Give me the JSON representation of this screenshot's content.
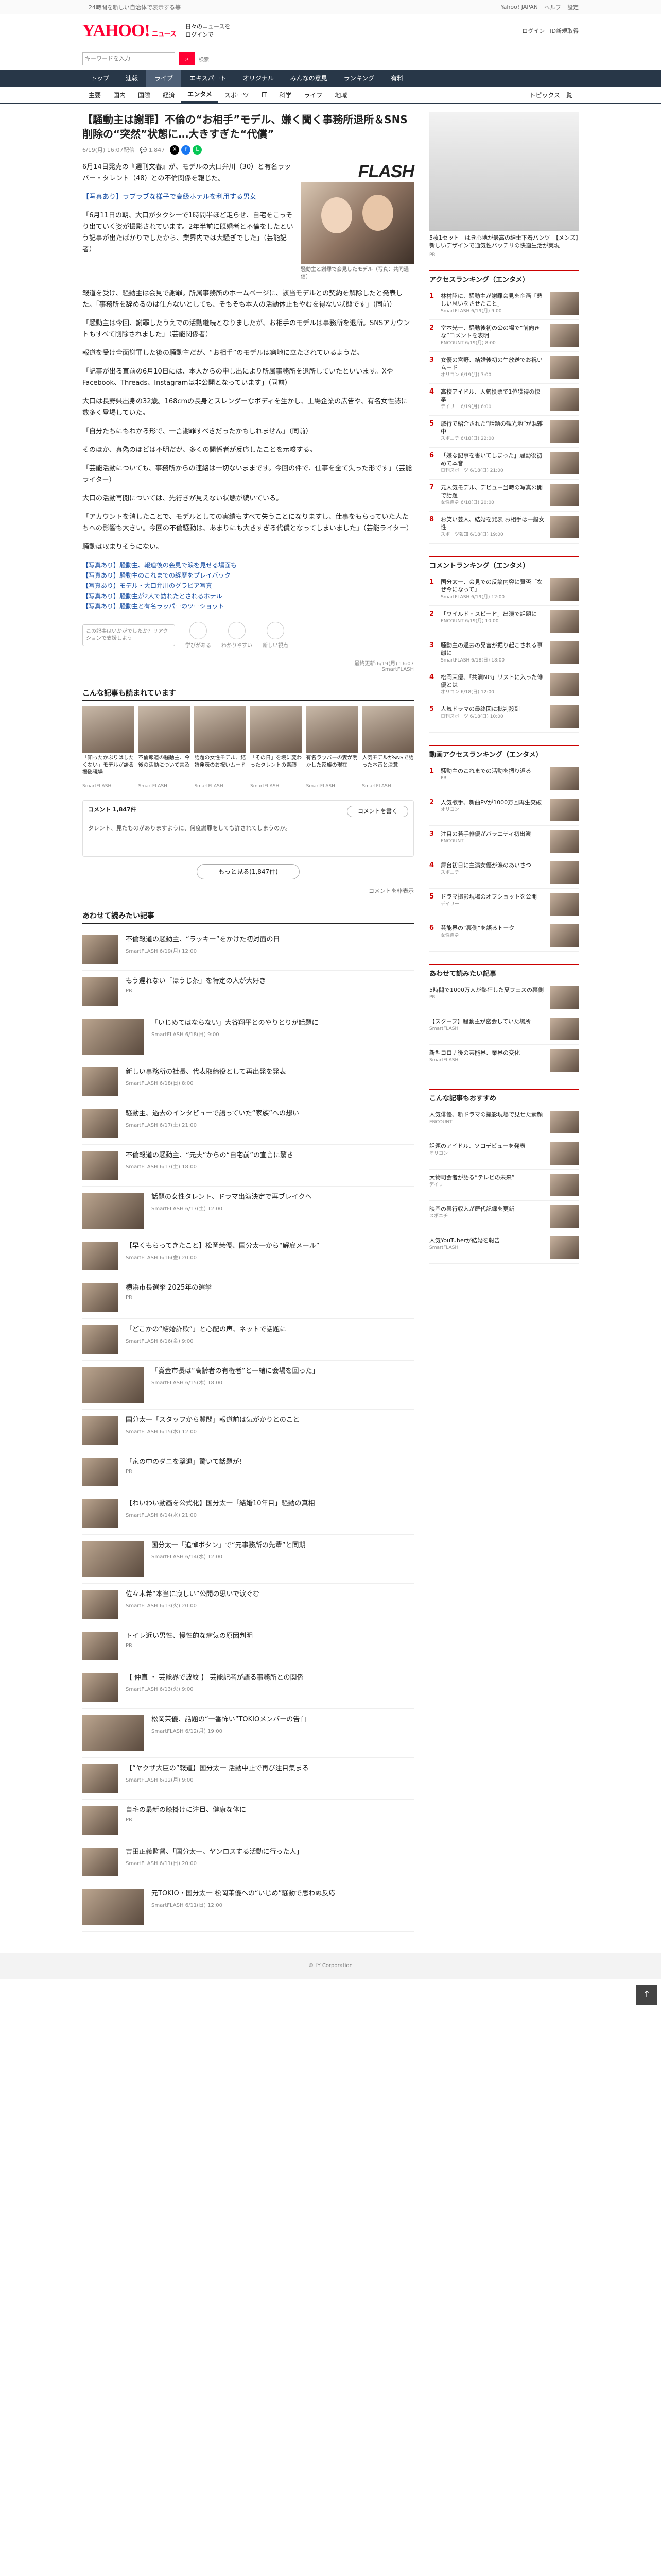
{
  "topbar": {
    "notice": "24時間を新しい自治体で表示する等",
    "login": "Yahoo! JAPAN",
    "help": "ヘルプ",
    "settings": "設定"
  },
  "header": {
    "logo": "YAHOO!",
    "logo_sub": "ニュース",
    "tagline1": "日々のニュースを",
    "tagline2": "ログインで",
    "links": [
      "ログイン",
      "ID新規取得"
    ]
  },
  "search": {
    "placeholder": "キーワードを入力",
    "button": "検索"
  },
  "nav": [
    "トップ",
    "速報",
    "ライブ",
    "エキスパート",
    "オリジナル",
    "みんなの意見",
    "ランキング",
    "有料"
  ],
  "subnav": [
    "主要",
    "国内",
    "国際",
    "経済",
    "エンタメ",
    "スポーツ",
    "IT",
    "科学",
    "ライフ",
    "地域"
  ],
  "subnav_right": "トピックス一覧",
  "article": {
    "title": "【騒動主は謝罪】不倫の“お相手”モデル、嫌く聞く事務所退所＆SNS削除の“突然”状態に…大きすぎた“代償”",
    "date": "6/19(月) 16:07配信",
    "comments": "1,847",
    "flash": "FLASH",
    "caption": "騒動主と謝罪で会見したモデル（写真：共同通信）",
    "paragraphs": [
      "6月14日発売の『週刊文春』が、モデルの大口弁川（30）と有名ラッパー・タレント（48）との不倫関係を報じた。",
      "【写真あり】ラブラブな様子で高級ホテルを利用する男女",
      "「6月11日の朝、大口がタクシーで1時間半ほど走らせ、自宅をこっそり出ていく姿が撮影されています。2年半前に既婚者と不倫をしたという記事が出たばかりでしたから、業界内では大騒ぎでした」（芸能記者）",
      "報道を受け、騒動主は会見で謝罪。所属事務所のホームページに、該当モデルとの契約を解除したと発表した。「事務所を辞めるのは仕方ないとしても、そもそも本人の活動休止もやむを得ない状態です」（同前）",
      "「騒動主は今回、謝罪したうえでの活動継続となりましたが、お相手のモデルは事務所を退所。SNSアカウントもすべて削除されました」（芸能関係者）",
      "報道を受け全面謝罪した後の騒動主だが、“お相手”のモデルは窮地に立たされているようだ。",
      "「記事が出る直前の6月10日には、本人からの申し出により所属事務所を退所していたといいます。XやFacebook、Threads、Instagramは非公開となっています」（同前）",
      "大口は長野県出身の32歳。168cmの長身とスレンダーなボディを生かし、上場企業の広告や、有名女性誌に数多く登場していた。",
      "「自分たちにもわかる形で、一言謝罪すべきだったかもしれません」（同前）",
      "そのほか、真偽のほどは不明だが、多くの関係者が反応したことを示唆する。",
      "「芸能活動についても、事務所からの連絡は一切ないままです。今回の件で、仕事を全て失った形です」（芸能ライター）",
      "大口の活動再開については、先行きが見えない状態が続いている。",
      "「アカウントを消したことで、モデルとしての実績もすべて失うことになりますし、仕事をもらっていた人たちへの影響も大きい。今回の不倫騒動は、あまりにも大きすぎる代償となってしまいました」（芸能ライター）",
      "騒動は収まりそうにない。"
    ],
    "related_links": [
      "【写真あり】騒動主、報道後の会見で涙を見せる場面も",
      "【写真あり】騒動主のこれまでの経歴をプレイバック",
      "【写真あり】モデル・大口弁川のグラビア写真",
      "【写真あり】騒動主が2人で訪れたとされるホテル",
      "【写真あり】騒動主と有名ラッパーのツーショット"
    ],
    "reaction_bubble": "この記事はいかがでしたか？リアクションで支援しよう",
    "reactions": [
      "学びがある",
      "わかりやすい",
      "新しい視点"
    ],
    "source": "最終更新:6/19(月) 16:07",
    "source_name": "SmartFLASH"
  },
  "related_section": "こんな記事も読まれています",
  "related": [
    {
      "title": "「知ったかぶりはしたくない」モデルが語る撮影現場",
      "caption": "SmartFLASH"
    },
    {
      "title": "不倫報道の騒動主、今後の活動について言及",
      "caption": "SmartFLASH"
    },
    {
      "title": "話題の女性モデル、結婚発表のお祝いムード",
      "caption": "SmartFLASH"
    },
    {
      "title": "「その日」を境に変わったタレントの素顔",
      "caption": "SmartFLASH"
    },
    {
      "title": "有名ラッパーの妻が明かした家族の現在",
      "caption": "SmartFLASH"
    },
    {
      "title": "人気モデルがSNSで語った本音と決意",
      "caption": "SmartFLASH"
    }
  ],
  "comments": {
    "title": "コメント 1,847件",
    "policy": "コメントを書く",
    "sample": "タレント、見たものがありますように、何度謝罪をしても許されてしまうのか。",
    "more": "もっと見る(1,847件)",
    "toggle": "コメントを非表示"
  },
  "list_section": "あわせて読みたい記事",
  "list": [
    {
      "title": "不倫報道の騒動主、“ラッキー”をかけた初対面の日",
      "caption": "SmartFLASH 6/19(月) 12:00"
    },
    {
      "title": "もう遅れない「ほうじ茶」を特定の人が大好き",
      "caption": "PR"
    },
    {
      "title": "「いじめてはならない」大谷翔平とのやりとりが話題に",
      "caption": "SmartFLASH 6/18(日) 9:00"
    },
    {
      "title": "新しい事務所の社長、代表取締役として再出発を発表",
      "caption": "SmartFLASH 6/18(日) 8:00"
    },
    {
      "title": "騒動主、過去のインタビューで語っていた“家族”への想い",
      "caption": "SmartFLASH 6/17(土) 21:00"
    },
    {
      "title": "不倫報道の騒動主、“元夫”からの“自宅前”の宣言に驚き",
      "caption": "SmartFLASH 6/17(土) 18:00"
    },
    {
      "title": "話題の女性タレント、ドラマ出演決定で再ブレイクへ",
      "caption": "SmartFLASH 6/17(土) 12:00"
    },
    {
      "title": "【早くもらってきたこと】松岡茉優、国分太一から“解雇メール”",
      "caption": "SmartFLASH 6/16(金) 20:00"
    },
    {
      "title": "横浜市長選挙 2025年の選挙",
      "caption": "PR"
    },
    {
      "title": "「どこかの“結婚詐欺”」と心配の声、ネットで話題に",
      "caption": "SmartFLASH 6/16(金) 9:00"
    },
    {
      "title": "「賞金市長は“高齢者の有権者”と一緒に会場を回った」",
      "caption": "SmartFLASH 6/15(木) 18:00"
    },
    {
      "title": "国分太一「スタッフから質問」報道前は気がかりとのこと",
      "caption": "SmartFLASH 6/15(木) 12:00"
    },
    {
      "title": "「家の中のダニを撃退」驚いて話題が！",
      "caption": "PR"
    },
    {
      "title": "【わいわい動画を公式化】国分太一「結婚10年目」騒動の真相",
      "caption": "SmartFLASH 6/14(水) 21:00"
    },
    {
      "title": "国分太一「追悼ボタン」で“元事務所の先輩”と同期",
      "caption": "SmartFLASH 6/14(水) 12:00"
    },
    {
      "title": "佐々木希“本当に寂しい”公開の思いで涙ぐむ",
      "caption": "SmartFLASH 6/13(火) 20:00"
    },
    {
      "title": "トイレ近い男性、慢性的な病気の原因判明",
      "caption": "PR"
    },
    {
      "title": "【 仲直 ・ 芸能界で波紋 】 芸能記者が語る事務所との関係",
      "caption": "SmartFLASH 6/13(火) 9:00"
    },
    {
      "title": "松岡茉優、話題の“一番怖い”TOKIOメンバーの告白",
      "caption": "SmartFLASH 6/12(月) 19:00"
    },
    {
      "title": "【“ヤクザ大臣の”報道】国分太一 活動中止で再び注目集まる",
      "caption": "SmartFLASH 6/12(月) 9:00"
    },
    {
      "title": "自宅の最新の膝掛けに注目、健康な体に",
      "caption": "PR"
    },
    {
      "title": "吉田正義監督、「国分太一、ヤンロスする活動に行った人」",
      "caption": "SmartFLASH 6/11(日) 20:00"
    },
    {
      "title": "元TOKIO・国分太一 松岡茉優への“いじめ”騒動で思わぬ反応",
      "caption": "SmartFLASH 6/11(日) 12:00"
    }
  ],
  "sidebar": {
    "ad_caption": "5枚1セット　はき心地が最高の紳士下着パンツ　【メンズ】新しいデザインで通気性バッチリの快適生活が実現",
    "ad_source": "PR",
    "access_title": "アクセスランキング（エンタメ）",
    "access": [
      {
        "title": "林村陸に、騒動主が謝罪会見を企画「悲しい思いをさせたこと」",
        "caption": "SmartFLASH 6/19(月) 9:00"
      },
      {
        "title": "堂本光一、騒動後初の公の場で“前向きな”コメントを表明",
        "caption": "ENCOUNT 6/19(月) 8:00"
      },
      {
        "title": "女優の宮野、結婚後初の生放送でお祝いムード",
        "caption": "オリコン 6/19(月) 7:00"
      },
      {
        "title": "高校アイドル、人気投票で1位獲得の快挙",
        "caption": "デイリー 6/19(月) 6:00"
      },
      {
        "title": "旅行で紹介された“話題の観光地”が混雑中",
        "caption": "スポニチ 6/18(日) 22:00"
      },
      {
        "title": "「嫌な記事を書いてしまった」騒動後初めて本音",
        "caption": "日刊スポーツ 6/18(日) 21:00"
      },
      {
        "title": "元人気モデル、デビュー当時の写真公開で話題",
        "caption": "女性自身 6/18(日) 20:00"
      },
      {
        "title": "お笑い芸人、結婚を発表 お相手は一般女性",
        "caption": "スポーツ報知 6/18(日) 19:00"
      }
    ],
    "comment_title": "コメントランキング（エンタメ）",
    "comment_rank": [
      {
        "title": "国分太一、会見での反論内容に賛否「なぜ今になって」",
        "caption": "SmartFLASH 6/19(月) 12:00"
      },
      {
        "title": "「ワイルド・スピード」出演で話題に",
        "caption": "ENCOUNT 6/19(月) 10:00"
      },
      {
        "title": "騒動主の過去の発言が掘り起こされる事態に",
        "caption": "SmartFLASH 6/18(日) 18:00"
      },
      {
        "title": "松岡茉優、「共演NG」リストに入った俳優とは",
        "caption": "オリコン 6/18(日) 12:00"
      },
      {
        "title": "人気ドラマの最終回に批判殺到",
        "caption": "日刊スポーツ 6/18(日) 10:00"
      }
    ],
    "playlist_title": "動画アクセスランキング（エンタメ）",
    "playlist": [
      {
        "title": "騒動主のこれまでの活動を振り返る",
        "caption": "PR"
      },
      {
        "title": "人気歌手、新曲PVが1000万回再生突破",
        "caption": "オリコン"
      },
      {
        "title": "注目の若手俳優がバラエティ初出演",
        "caption": "ENCOUNT"
      },
      {
        "title": "舞台初日に主演女優が涙のあいさつ",
        "caption": "スポニチ"
      },
      {
        "title": "ドラマ撮影現場のオフショットを公開",
        "caption": "デイリー"
      },
      {
        "title": "芸能界の“裏側”を語るトーク",
        "caption": "女性自身"
      }
    ],
    "pr_title": "あわせて読みたい記事",
    "pr": [
      {
        "title": "5時間で1000万人が熱狂した夏フェスの裏側",
        "caption": "PR"
      },
      {
        "title": "【スクープ】騒動主が密会していた場所",
        "caption": "SmartFLASH"
      },
      {
        "title": "新型コロナ後の芸能界、業界の変化",
        "caption": "SmartFLASH"
      }
    ],
    "extra_title": "こんな記事もおすすめ",
    "extra": [
      {
        "title": "人気俳優、新ドラマの撮影現場で見せた素顔",
        "caption": "ENCOUNT"
      },
      {
        "title": "話題のアイドル、ソロデビューを発表",
        "caption": "オリコン"
      },
      {
        "title": "大物司会者が語る“テレビの未来”",
        "caption": "デイリー"
      },
      {
        "title": "映画の興行収入が歴代記録を更新",
        "caption": "スポニチ"
      },
      {
        "title": "人気YouTuberが結婚を報告",
        "caption": "SmartFLASH"
      }
    ]
  },
  "pagetop": "↑",
  "footer": "© LY Corporation"
}
